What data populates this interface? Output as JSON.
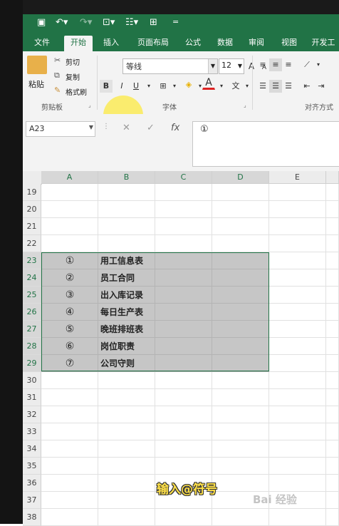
{
  "quick_access": {
    "save_icon": "save-icon",
    "undo_icon": "undo-icon",
    "redo_icon": "redo-icon",
    "customize": "="
  },
  "ribbon_tabs": [
    {
      "label": "文件",
      "active": false
    },
    {
      "label": "开始",
      "active": true
    },
    {
      "label": "插入",
      "active": false
    },
    {
      "label": "页面布局",
      "active": false
    },
    {
      "label": "公式",
      "active": false
    },
    {
      "label": "数据",
      "active": false
    },
    {
      "label": "审阅",
      "active": false
    },
    {
      "label": "视图",
      "active": false
    },
    {
      "label": "开发工",
      "active": false
    }
  ],
  "clipboard": {
    "paste_label": "粘贴",
    "cut_label": "剪切",
    "copy_label": "复制",
    "format_painter_label": "格式刷",
    "group_label": "剪贴板"
  },
  "font": {
    "font_name": "等线",
    "font_size": "12",
    "bold": "B",
    "italic": "I",
    "underline": "U",
    "font_color": "A",
    "grow": "A",
    "shrink": "A",
    "phonetic": "文",
    "group_label": "字体"
  },
  "alignment": {
    "group_label": "对齐方式"
  },
  "formula_bar": {
    "name_box": "A23",
    "fx_label": "fx",
    "content": "①"
  },
  "columns": [
    "A",
    "B",
    "C",
    "D",
    "E"
  ],
  "rows": [
    "19",
    "20",
    "21",
    "22",
    "23",
    "24",
    "25",
    "26",
    "27",
    "28",
    "29",
    "30",
    "31",
    "32",
    "33",
    "34",
    "35",
    "36",
    "37",
    "38"
  ],
  "table": [
    {
      "row": "23",
      "a": "①",
      "b": "用工信息表"
    },
    {
      "row": "24",
      "a": "②",
      "b": "员工合同"
    },
    {
      "row": "25",
      "a": "③",
      "b": "出入库记录"
    },
    {
      "row": "26",
      "a": "④",
      "b": "每日生产表"
    },
    {
      "row": "27",
      "a": "⑤",
      "b": "晚班排班表"
    },
    {
      "row": "28",
      "a": "⑥",
      "b": "岗位职责"
    },
    {
      "row": "29",
      "a": "⑦",
      "b": "公司守则"
    }
  ],
  "caption": "输入@符号",
  "watermark": "Bai 经验",
  "colors": {
    "accent": "#217346",
    "selection_fill": "#c6c6c6",
    "caption": "#ffe14a"
  }
}
